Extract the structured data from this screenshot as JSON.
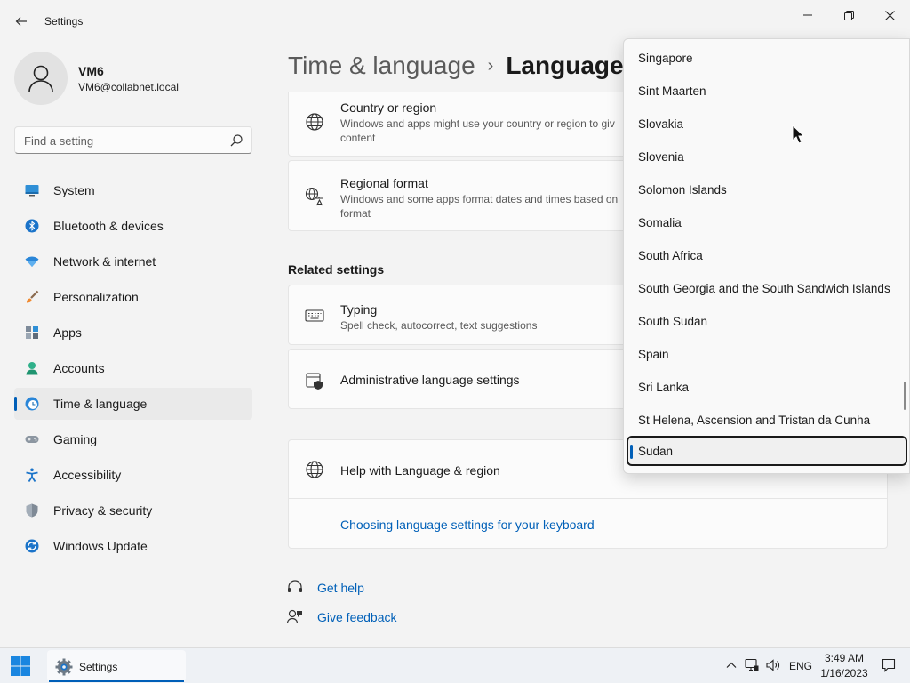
{
  "window": {
    "title": "Settings"
  },
  "profile": {
    "name": "VM6",
    "email": "VM6@collabnet.local"
  },
  "search": {
    "placeholder": "Find a setting",
    "value": ""
  },
  "sidebar": {
    "items": [
      {
        "label": "System",
        "icon": "monitor-icon"
      },
      {
        "label": "Bluetooth & devices",
        "icon": "bluetooth-icon"
      },
      {
        "label": "Network & internet",
        "icon": "wifi-icon"
      },
      {
        "label": "Personalization",
        "icon": "brush-icon"
      },
      {
        "label": "Apps",
        "icon": "apps-icon"
      },
      {
        "label": "Accounts",
        "icon": "person-icon"
      },
      {
        "label": "Time & language",
        "icon": "globe-clock-icon",
        "active": true
      },
      {
        "label": "Gaming",
        "icon": "gamepad-icon"
      },
      {
        "label": "Accessibility",
        "icon": "accessibility-icon"
      },
      {
        "label": "Privacy & security",
        "icon": "shield-icon"
      },
      {
        "label": "Windows Update",
        "icon": "update-icon"
      }
    ]
  },
  "breadcrumb": {
    "parent": "Time & language",
    "separator": "›",
    "current": "Language"
  },
  "main": {
    "country_card": {
      "title": "Country or region",
      "desc": "Windows and apps might use your country or region to giv content"
    },
    "regional_card": {
      "title": "Regional format",
      "desc": "Windows and some apps format dates and times based on format"
    },
    "related_heading": "Related settings",
    "typing_card": {
      "title": "Typing",
      "desc": "Spell check, autocorrect, text suggestions"
    },
    "admin_card": {
      "title": "Administrative language settings"
    },
    "help_card": {
      "title": "Help with Language & region",
      "link": "Choosing language settings for your keyboard"
    },
    "footer": {
      "get_help": "Get help",
      "give_feedback": "Give feedback"
    }
  },
  "dropdown": {
    "items": [
      "Singapore",
      "Sint Maarten",
      "Slovakia",
      "Slovenia",
      "Solomon Islands",
      "Somalia",
      "South Africa",
      "South Georgia and the South Sandwich Islands",
      "South Sudan",
      "Spain",
      "Sri Lanka",
      "St Helena, Ascension and Tristan da Cunha",
      "Sudan"
    ],
    "selected": "Sudan"
  },
  "taskbar": {
    "app_label": "Settings",
    "lang": "ENG",
    "time": "3:49 AM",
    "date": "1/16/2023"
  },
  "colors": {
    "accent": "#005fb8",
    "link": "#0060b8",
    "background": "#f3f3f3",
    "card": "#fbfbfb"
  }
}
